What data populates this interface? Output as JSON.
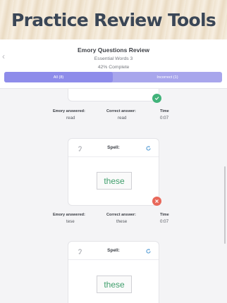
{
  "banner": {
    "title": "Practice Review Tools"
  },
  "header": {
    "back_icon": "chevron-left-icon",
    "title": "Emory Questions Review",
    "subtitle": "Essential Words 3",
    "progress": "42% Complete",
    "tabs": [
      {
        "label": "All (8)",
        "selected": true
      },
      {
        "label": "Incorrect (1)",
        "selected": false
      }
    ]
  },
  "results": [
    {
      "spell_label": "",
      "word": "",
      "status": "correct",
      "answered_label": "Emory answered:",
      "answered": "read",
      "correct_label": "Correct answer:",
      "correct": "read",
      "time_label": "Time",
      "time": "0:07"
    },
    {
      "spell_label": "Spell:",
      "word": "these",
      "status": "incorrect",
      "answered_label": "Emory answered:",
      "answered": "tese",
      "correct_label": "Correct answer:",
      "correct": "these",
      "time_label": "Time",
      "time": "0:07"
    },
    {
      "spell_label": "Spell:",
      "word": "these",
      "status": "unknown"
    }
  ],
  "colors": {
    "accent": "#8e8cea",
    "correct": "#41b37a",
    "incorrect": "#e8685a",
    "word": "#3f9e6b"
  }
}
